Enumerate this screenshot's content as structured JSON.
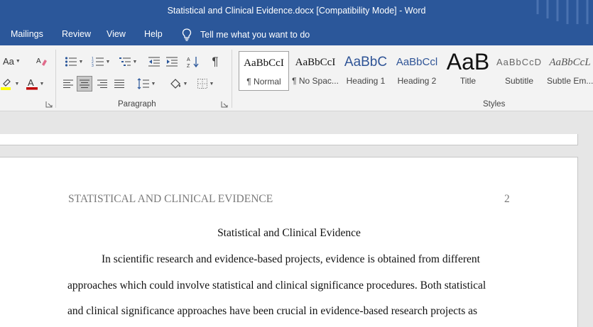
{
  "window": {
    "title_file": "Statistical and Clinical Evidence.docx",
    "title_mode": "[Compatibility Mode]",
    "title_sep": "-",
    "title_app": "Word"
  },
  "menu": {
    "tabs": [
      "Mailings",
      "Review",
      "View",
      "Help"
    ],
    "tell_me": "Tell me what you want to do"
  },
  "ribbon": {
    "font_group": {
      "change_case": "Aa",
      "font_color_accent": "#c00000",
      "highlight_accent": "#ffff00"
    },
    "paragraph_group": {
      "label": "Paragraph",
      "selected_alignment": "align-left"
    },
    "styles_group": {
      "label": "Styles",
      "items": [
        {
          "sample": "AaBbCcI",
          "name": "¶ Normal"
        },
        {
          "sample": "AaBbCcI",
          "name": "¶ No Spac..."
        },
        {
          "sample": "AaBbC",
          "name": "Heading 1"
        },
        {
          "sample": "AaBbCcl",
          "name": "Heading 2"
        },
        {
          "sample": "AaB",
          "name": "Title"
        },
        {
          "sample": "AaBbCcD",
          "name": "Subtitle"
        },
        {
          "sample": "AaBbCcL",
          "name": "Subtle Em..."
        }
      ]
    }
  },
  "document": {
    "running_head": "STATISTICAL AND CLINICAL EVIDENCE",
    "page_number": "2",
    "title": "Statistical and Clinical Evidence",
    "lines": [
      "In scientific research and evidence-based projects, evidence is obtained from different",
      "approaches which could involve statistical and clinical significance procedures. Both statistical",
      "and clinical significance approaches have been crucial in evidence-based research projects as"
    ]
  },
  "colors": {
    "brand": "#2b579a",
    "ribbon": "#f3f3f3",
    "canvas": "#e6e6e6",
    "heading_blue": "#2f5496"
  }
}
